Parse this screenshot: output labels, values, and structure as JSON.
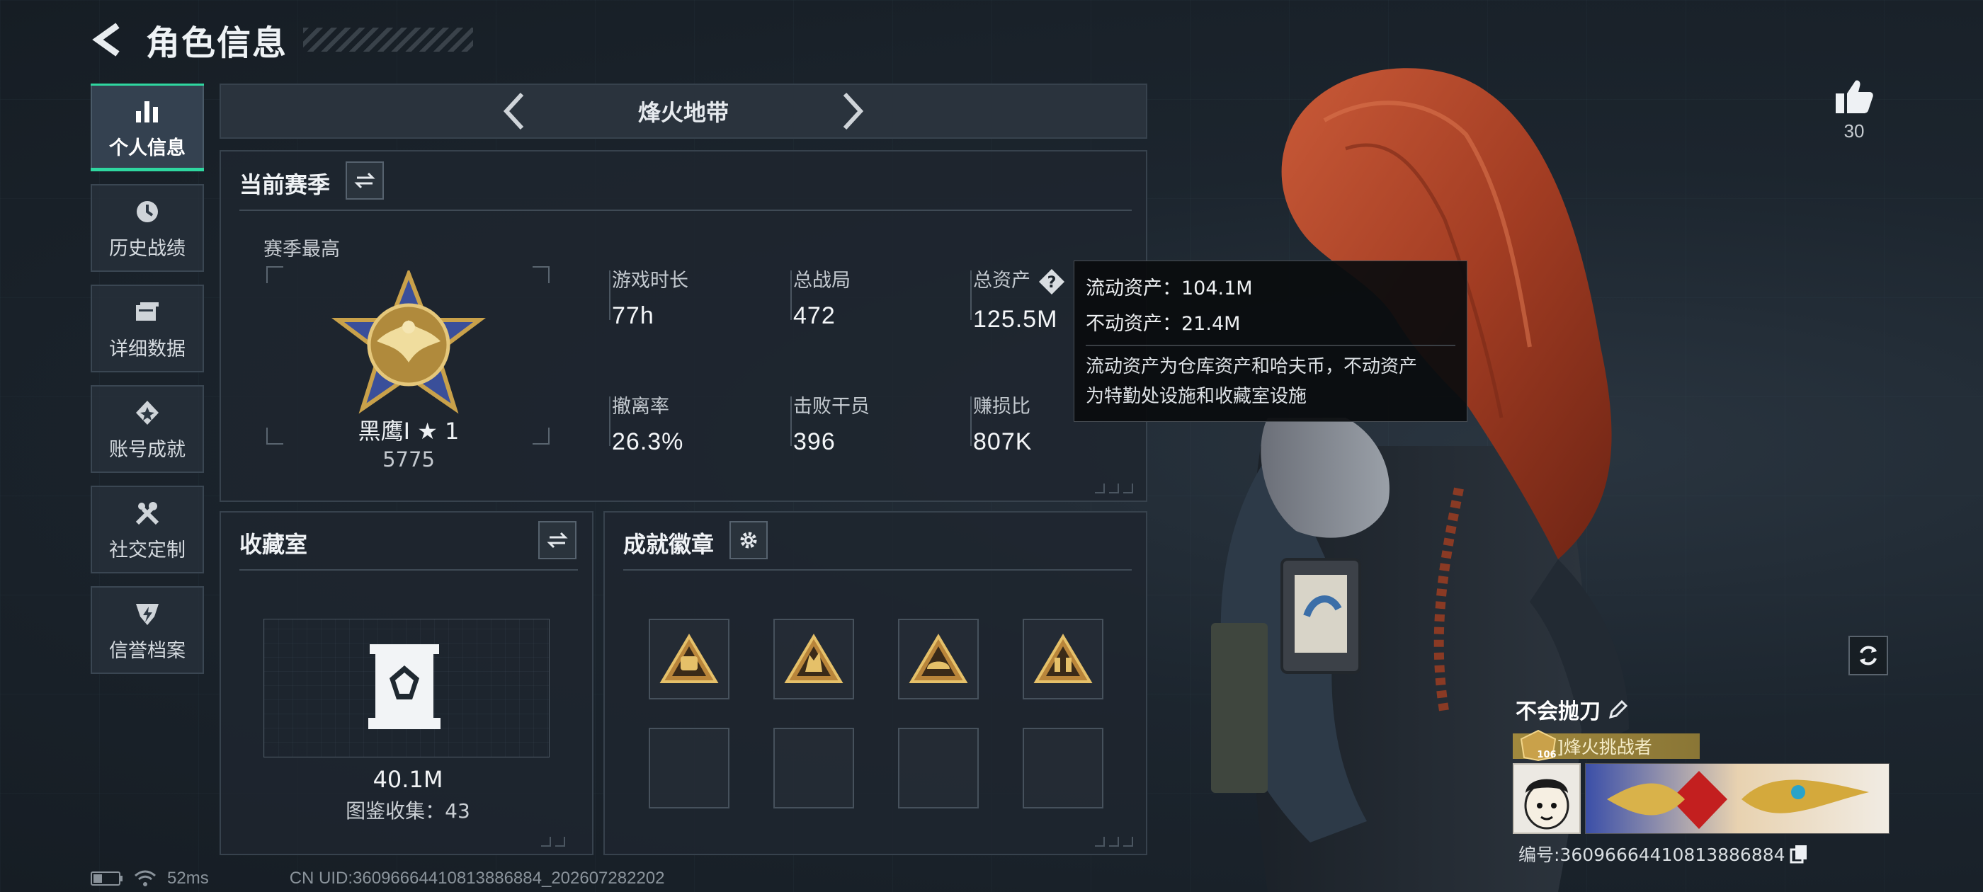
{
  "header": {
    "title": "角色信息"
  },
  "sidebar": {
    "items": [
      {
        "label": "个人信息",
        "icon": "bar-chart-icon",
        "active": true
      },
      {
        "label": "历史战绩",
        "icon": "history-clock-icon"
      },
      {
        "label": "详细数据",
        "icon": "folder-icon"
      },
      {
        "label": "账号成就",
        "icon": "achievement-icon"
      },
      {
        "label": "社交定制",
        "icon": "tools-icon"
      },
      {
        "label": "信誉档案",
        "icon": "credit-shield-icon"
      }
    ]
  },
  "mode": {
    "title": "烽火地带"
  },
  "season": {
    "title": "当前赛季",
    "best_label": "赛季最高",
    "rank_name": "黑鹰I ★ 1",
    "rank_score": "5775",
    "stats": {
      "playtime_label": "游戏时长",
      "playtime": "77h",
      "matches_label": "总战局",
      "matches": "472",
      "assets_label": "总资产",
      "assets": "125.5M",
      "extract_label": "撤离率",
      "extract": "26.3%",
      "kills_label": "击败干员",
      "kills": "396",
      "profit_label": "赚损比",
      "profit": "807K"
    }
  },
  "tooltip": {
    "liquid": "流动资产：104.1M",
    "fixed": "不动资产：21.4M",
    "desc_line1": "流动资产为仓库资产和哈夫币，不动资产",
    "desc_line2": "为特勤处设施和收藏室设施"
  },
  "collection": {
    "title": "收藏室",
    "value": "40.1M",
    "count": "图鉴收集：43"
  },
  "badges": {
    "title": "成就徽章"
  },
  "likes": {
    "count": "30"
  },
  "player": {
    "name": "不会抛刀",
    "level": "106",
    "title": "]烽火挑战者",
    "id": "编号:36096664410813886884"
  },
  "status": {
    "ping": "52ms",
    "uid": "CN UID:36096664410813886884_202607282202"
  },
  "colors": {
    "accent": "#2fd7a0",
    "gold": "#c9a14a",
    "hair": "#b8482c"
  }
}
